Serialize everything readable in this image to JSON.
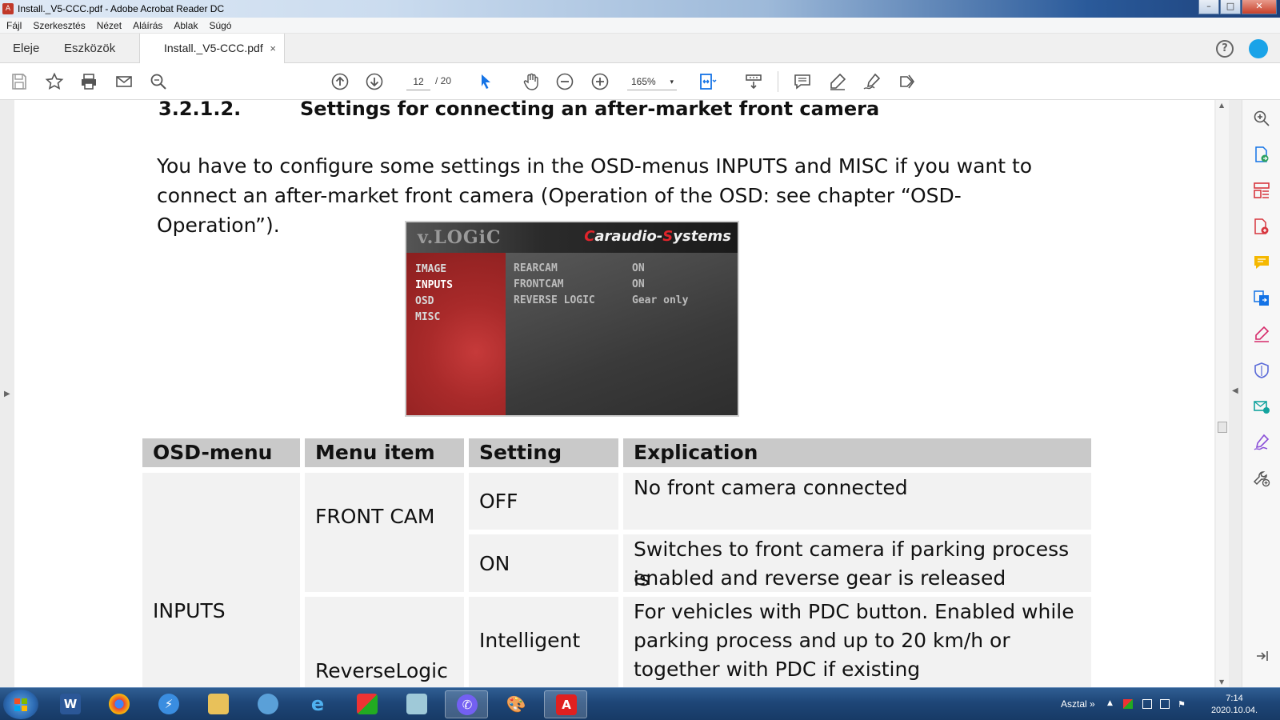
{
  "window": {
    "title": "Install._V5-CCC.pdf - Adobe Acrobat Reader DC"
  },
  "menubar": {
    "items": [
      "Fájl",
      "Szerkesztés",
      "Nézet",
      "Aláírás",
      "Ablak",
      "Súgó"
    ]
  },
  "tabs": {
    "home": "Eleje",
    "tools": "Eszközök",
    "document": "Install._V5-CCC.pdf",
    "close_glyph": "×",
    "help_glyph": "?"
  },
  "toolbar": {
    "current_page": "12",
    "page_total": "/ 20",
    "zoom": "165%",
    "zoom_arrow": "▾"
  },
  "document": {
    "heading_number": "3.2.1.2.",
    "heading_text": "Settings for connecting an after-market front camera",
    "paragraph_line1": "You have to configure some settings in the OSD-menus INPUTS and MISC if you want to",
    "paragraph_line2": "connect an after-market front camera (Operation of the OSD: see chapter “OSD-Operation”).",
    "osd_image": {
      "logo": "v.LOGiC",
      "brand_first_letter": "C",
      "brand_mid": "araudio-",
      "brand_s": "S",
      "brand_end": "ystems",
      "menu": [
        "IMAGE",
        "INPUTS",
        "OSD",
        "MISC"
      ],
      "items": [
        {
          "name": "REARCAM",
          "value": "ON"
        },
        {
          "name": "FRONTCAM",
          "value": "ON"
        },
        {
          "name": "REVERSE LOGIC",
          "value": "Gear only"
        }
      ]
    },
    "table": {
      "headers": [
        "OSD-menu",
        "Menu item",
        "Setting",
        "Explication"
      ],
      "menu": "INPUTS",
      "item_front_cam": "FRONT CAM",
      "item_reverse_logic": "ReverseLogic",
      "rows": [
        {
          "setting": "OFF",
          "explication": [
            "No front camera connected"
          ]
        },
        {
          "setting": "ON",
          "explication": [
            "Switches to front camera if parking process is",
            "enabled and reverse gear is released"
          ]
        },
        {
          "setting": "Intelligent",
          "explication": [
            "For vehicles with PDC button. Enabled while",
            "parking process and up to 20 km/h or",
            "together with PDC if existing"
          ]
        }
      ]
    }
  },
  "taskbar": {
    "desktop_label": "Asztal",
    "chevron": "»",
    "time": "7:14",
    "date": "2020.10.04."
  },
  "colors": {
    "acrobat_red": "#e02020",
    "accent_blue": "#1473e6",
    "taskbar": "#1e4677"
  }
}
